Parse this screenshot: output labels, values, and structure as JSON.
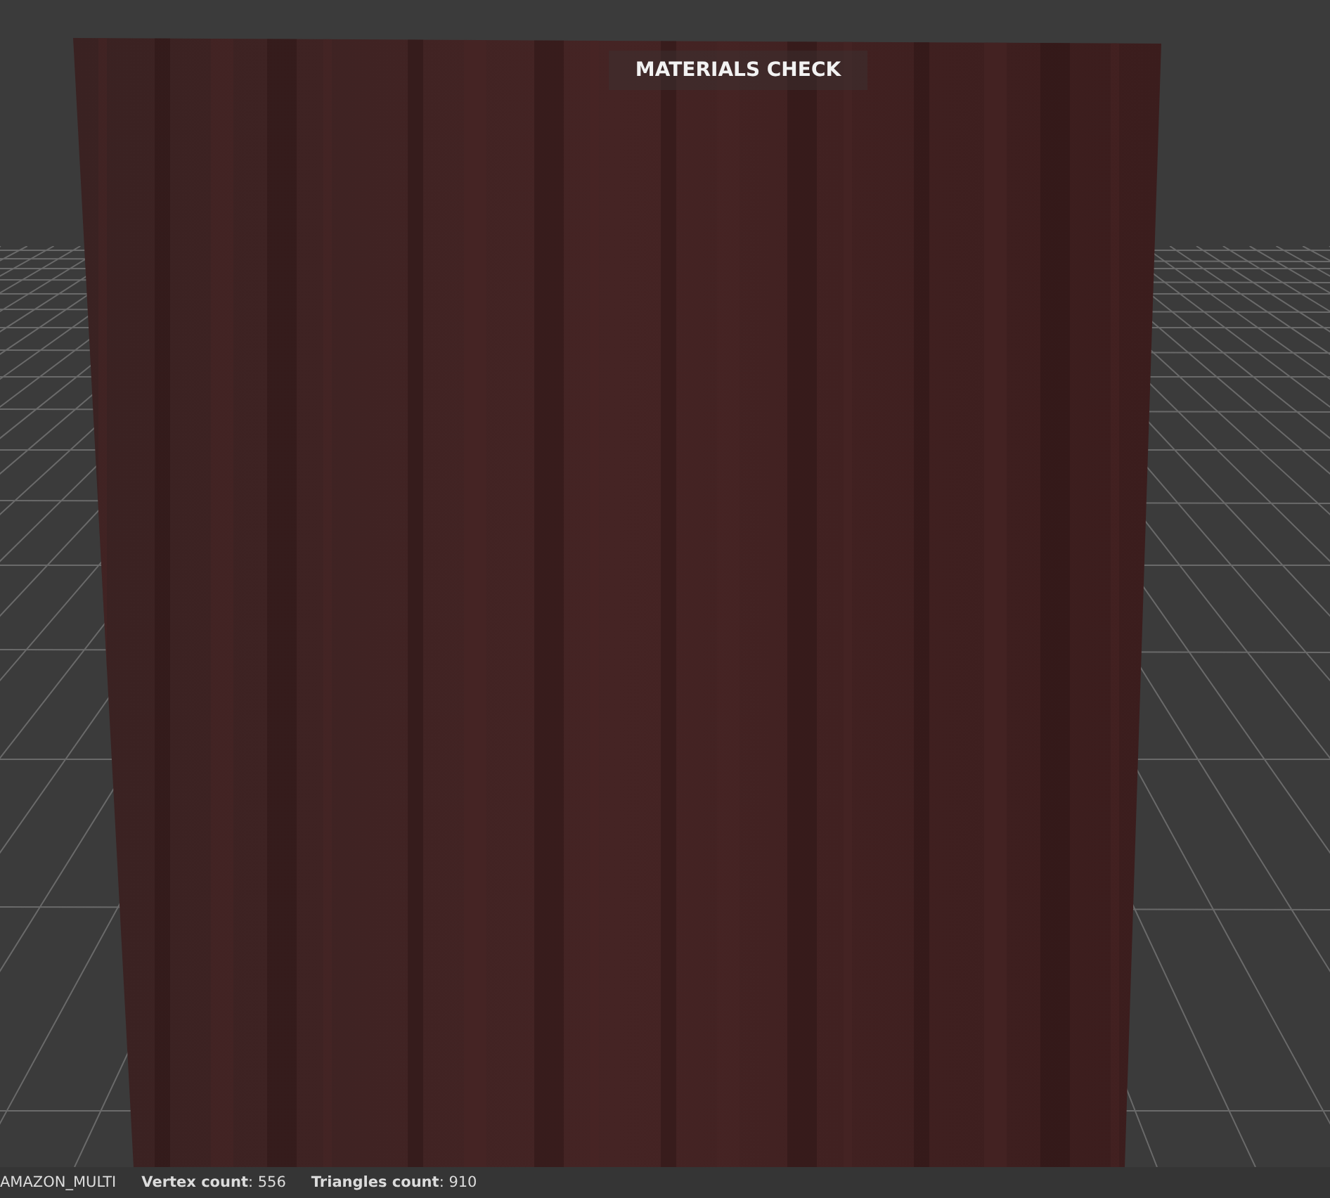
{
  "viewport": {
    "title": "MATERIALS CHECK"
  },
  "status_bar": {
    "items": [
      {
        "text": "AMAZON_MULTI"
      },
      {
        "text": "**Vertex count**: 556"
      },
      {
        "text": "**Triangles count**: 910"
      }
    ]
  }
}
